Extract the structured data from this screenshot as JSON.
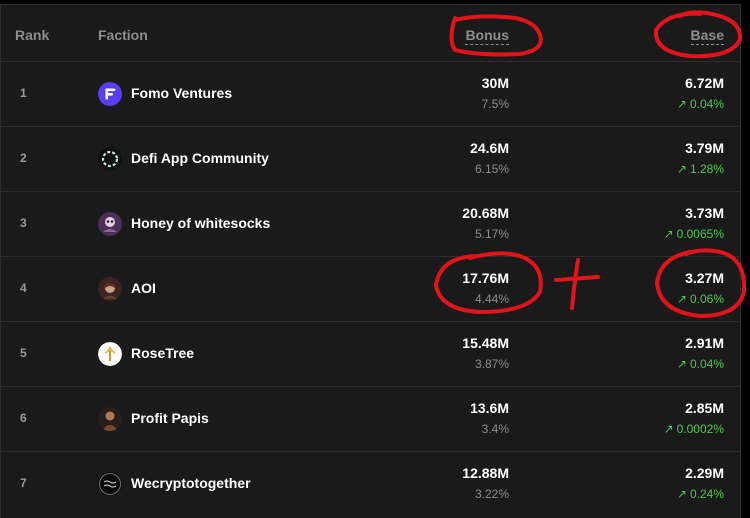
{
  "header": {
    "rank": "Rank",
    "faction": "Faction",
    "bonus": "Bonus",
    "base": "Base"
  },
  "rows": [
    {
      "rank": "1",
      "name": "Fomo Ventures",
      "logo": "fomo-ventures-logo",
      "bonus": "30M",
      "bonus_pct": "7.5%",
      "base": "6.72M",
      "base_change": "0.04%"
    },
    {
      "rank": "2",
      "name": "Defi App Community",
      "logo": "defi-app-logo",
      "bonus": "24.6M",
      "bonus_pct": "6.15%",
      "base": "3.79M",
      "base_change": "1.28%"
    },
    {
      "rank": "3",
      "name": "Honey of whitesocks",
      "logo": "honey-whitesocks-logo",
      "bonus": "20.68M",
      "bonus_pct": "5.17%",
      "base": "3.73M",
      "base_change": "0.0065%"
    },
    {
      "rank": "4",
      "name": "AOI",
      "logo": "aoi-logo",
      "bonus": "17.76M",
      "bonus_pct": "4.44%",
      "base": "3.27M",
      "base_change": "0.06%"
    },
    {
      "rank": "5",
      "name": "RoseTree",
      "logo": "rosetree-logo",
      "bonus": "15.48M",
      "bonus_pct": "3.87%",
      "base": "2.91M",
      "base_change": "0.04%"
    },
    {
      "rank": "6",
      "name": "Profit Papis",
      "logo": "profit-papis-logo",
      "bonus": "13.6M",
      "bonus_pct": "3.4%",
      "base": "2.85M",
      "base_change": "0.0002%"
    },
    {
      "rank": "7",
      "name": "Wecryptotogether",
      "logo": "wecryptotogether-logo",
      "bonus": "12.88M",
      "bonus_pct": "3.22%",
      "base": "2.29M",
      "base_change": "0.24%"
    }
  ],
  "colors": {
    "background": "#1b1a1a",
    "border": "#2f2e2e",
    "muted_text": "#8e8d8d",
    "positive": "#4ec84e",
    "annotation": "#e0141a"
  },
  "icons": {
    "up_arrow": "arrow-up-right-icon"
  }
}
